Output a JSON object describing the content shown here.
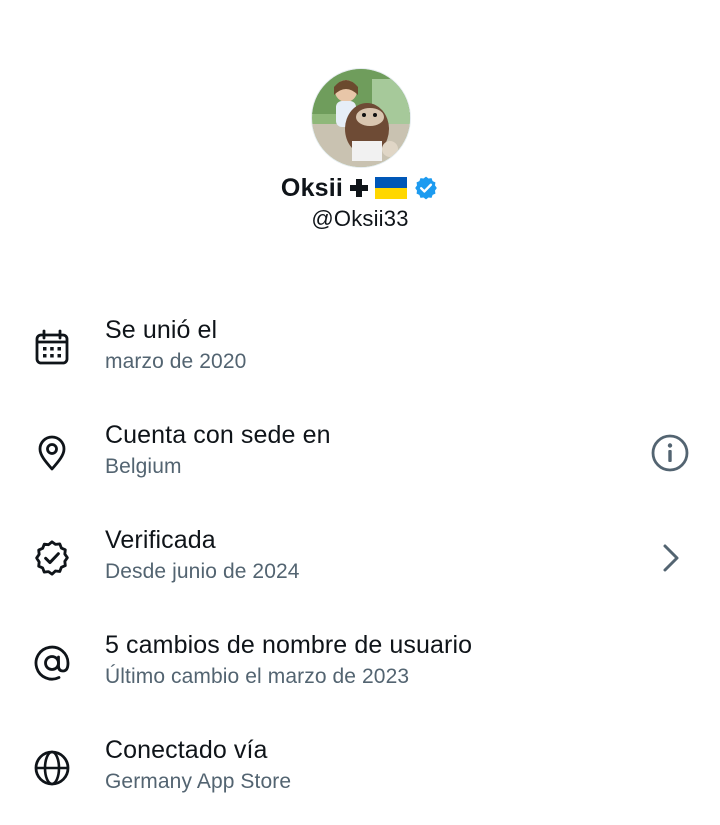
{
  "profile": {
    "display_name": "Oksii",
    "handle": "@Oksii33",
    "verified": true,
    "badges": [
      "cross-icon",
      "ukraine-flag-icon",
      "verified-badge-icon"
    ]
  },
  "about": {
    "rows": [
      {
        "icon": "calendar-icon",
        "title": "Se unió el",
        "subtitle": "marzo de 2020",
        "trailing": null
      },
      {
        "icon": "location-pin-icon",
        "title": "Cuenta con sede en",
        "subtitle": "Belgium",
        "trailing": "info-icon"
      },
      {
        "icon": "verified-outline-icon",
        "title": "Verificada",
        "subtitle": "Desde junio de 2024",
        "trailing": "chevron-right-icon"
      },
      {
        "icon": "at-sign-icon",
        "title": "5 cambios de nombre de usuario",
        "subtitle": "Último cambio el marzo de 2023",
        "trailing": null
      },
      {
        "icon": "globe-icon",
        "title": "Conectado vía",
        "subtitle": "Germany App Store",
        "trailing": null
      }
    ]
  },
  "colors": {
    "text_primary": "#0f1419",
    "text_secondary": "#536471",
    "verified_blue": "#1d9bf0",
    "flag_blue": "#0057b7",
    "flag_yellow": "#ffd700"
  }
}
